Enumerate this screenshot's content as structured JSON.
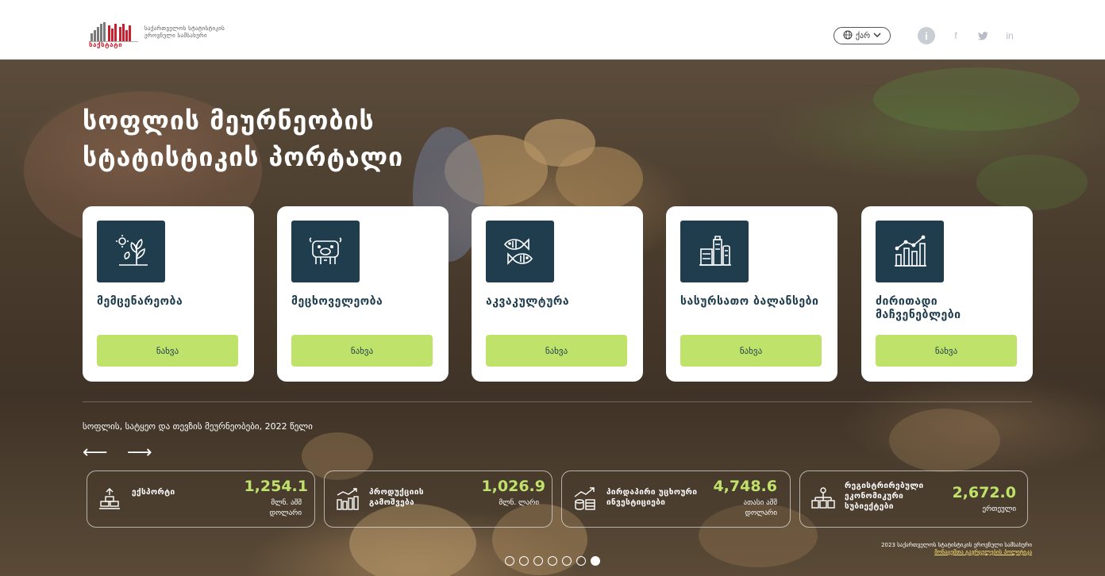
{
  "header": {
    "logo_word": "საქსტატი",
    "org_line1": "საქართველოს სტატისტიკის",
    "org_line2": "ეროვნული სამსახური",
    "lang_label": "ქარ",
    "social_icons": [
      "info-icon",
      "facebook-icon",
      "twitter-icon",
      "linkedin-icon"
    ]
  },
  "hero": {
    "title_line1": "სოფლის მეურნეობის",
    "title_line2": "სტატისტიკის პორტალი"
  },
  "cards": [
    {
      "title": "მემცენარეობა",
      "button": "ნახვა",
      "icon": "plant-icon"
    },
    {
      "title": "მეცხოველეობა",
      "button": "ნახვა",
      "icon": "cow-icon"
    },
    {
      "title": "აკვაკულტურა",
      "button": "ნახვა",
      "icon": "fish-icon"
    },
    {
      "title": "სასურსათო ბალანსები",
      "button": "ნახვა",
      "icon": "food-icon"
    },
    {
      "title": "ძირითადი მაჩვენებლები",
      "button": "ნახვა",
      "icon": "chart-icon"
    }
  ],
  "stats": {
    "caption": "სოფლის, სატყეო და თევზის მეურნეობები, 2022 წელი",
    "prev_arrow": "⟵",
    "next_arrow": "⟶",
    "items": [
      {
        "label_line1": "ექსპორტი",
        "label_line2": "",
        "label_line3": "",
        "value": "1,254.1",
        "unit_line1": "მლნ. აშშ",
        "unit_line2": "დოლარი",
        "icon": "export-icon"
      },
      {
        "label_line1": "პროდუქციის",
        "label_line2": "გამოშვება",
        "label_line3": "",
        "value": "1,026.9",
        "unit_line1": "მლნ. ლარი",
        "unit_line2": "",
        "icon": "output-icon"
      },
      {
        "label_line1": "პირდაპირი უცხოური",
        "label_line2": "ინვესტიციები",
        "label_line3": "",
        "value": "4,748.6",
        "unit_line1": "ათასი აშშ",
        "unit_line2": "დოლარი",
        "icon": "investment-icon"
      },
      {
        "label_line1": "რეგისტრირებული",
        "label_line2": "ეკონომიკური",
        "label_line3": "სუბიექტები",
        "value": "2,672.0",
        "unit_line1": "ერთეული",
        "unit_line2": "",
        "icon": "entities-icon"
      }
    ]
  },
  "footer": {
    "copyright": "2023 საქართველოს სტატისტიკის ეროვნული სამსახური",
    "policy_link": "მონაცემთა გავრცელების პოლიტიკა"
  },
  "carousel": {
    "count": 7,
    "active_index": 6
  },
  "colors": {
    "accent": "#bfe36a",
    "dark_teal": "#1f3d4d",
    "brand_red": "#c8202f"
  }
}
